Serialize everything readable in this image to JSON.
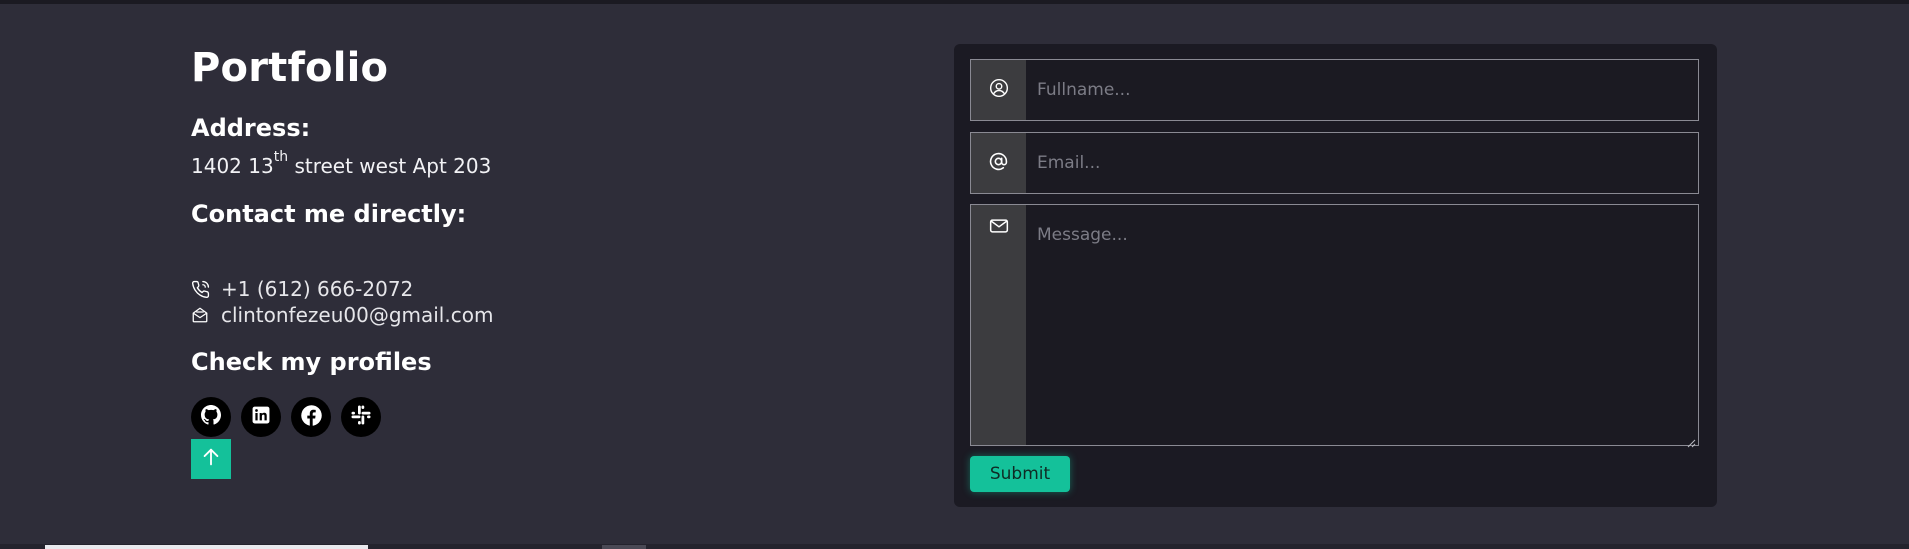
{
  "left": {
    "title": "Portfolio",
    "address_heading": "Address:",
    "address_main": "1402 13",
    "address_sup": "th",
    "address_rest": " street west Apt 203",
    "contact_heading": "Contact me directly:",
    "phone": "+1 (612) 666-2072",
    "email": "clintonfezeu00@gmail.com",
    "profiles_heading": "Check my profiles",
    "socials": [
      {
        "icon": "github-icon"
      },
      {
        "icon": "linkedin-icon"
      },
      {
        "icon": "facebook-icon"
      },
      {
        "icon": "slack-icon"
      }
    ],
    "scroll_top_icon": "arrow-up-icon"
  },
  "form": {
    "fullname_placeholder": "Fullname...",
    "email_placeholder": "Email...",
    "message_placeholder": "Message...",
    "submit_label": "Submit"
  },
  "colors": {
    "background": "#2e2d39",
    "card": "#1b1a23",
    "accent": "#14c19a",
    "addon": "#3c3c3f"
  }
}
